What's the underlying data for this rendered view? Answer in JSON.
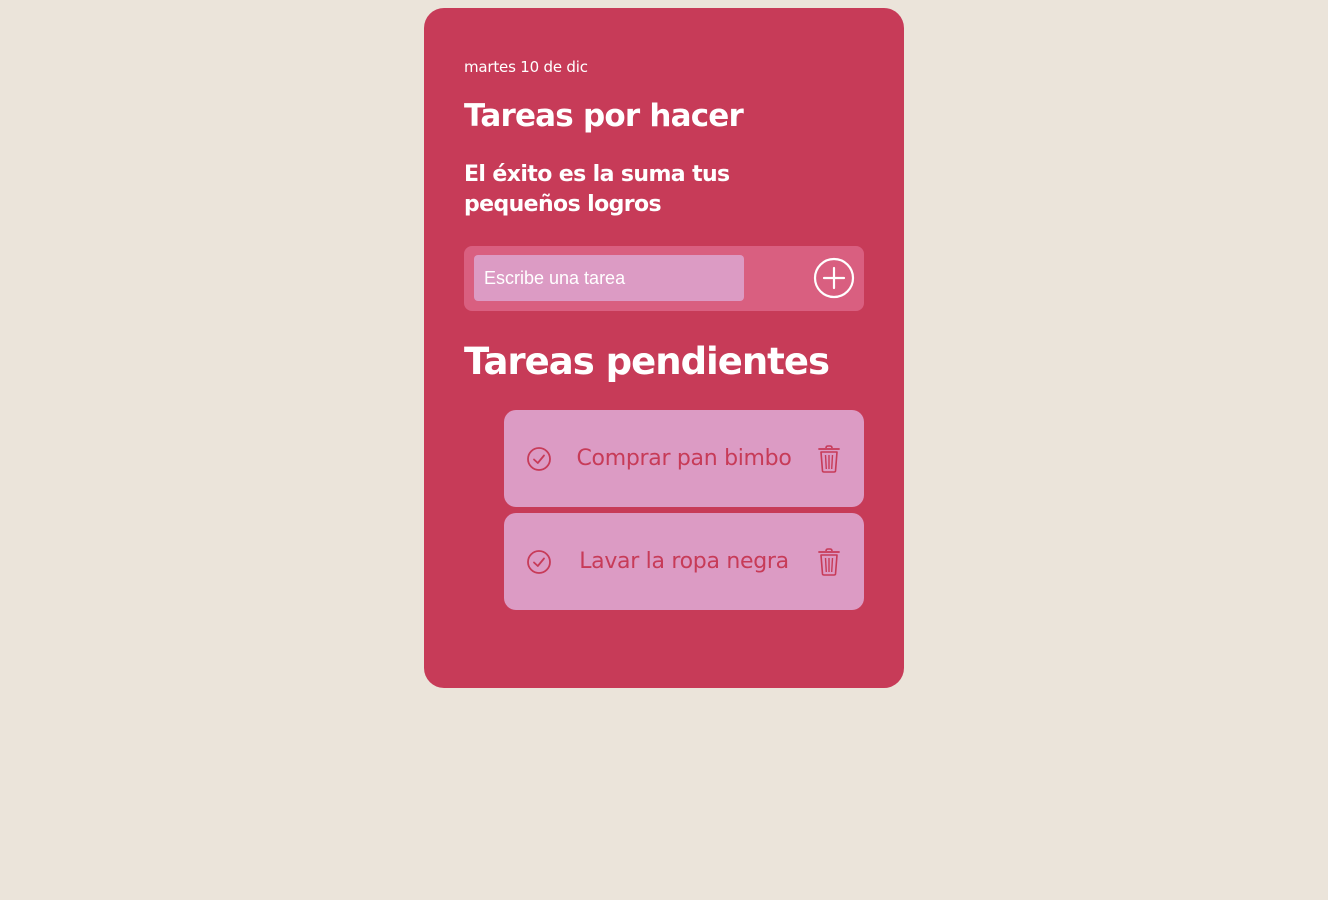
{
  "header": {
    "date": "martes 10 de dic",
    "title": "Tareas por hacer",
    "subtitle": "El éxito es la suma tus pequeños logros"
  },
  "input": {
    "placeholder": "Escribe una tarea",
    "value": "",
    "add_icon": "plus-circle-icon"
  },
  "pending": {
    "title": "Tareas pendientes",
    "tasks": [
      {
        "text": "Comprar pan bimbo",
        "check_icon": "check-circle-icon",
        "delete_icon": "trash-icon"
      },
      {
        "text": "Lavar la ropa negra",
        "check_icon": "check-circle-icon",
        "delete_icon": "trash-icon"
      }
    ]
  },
  "colors": {
    "background": "#ebe4da",
    "card": "#c73b58",
    "input_row": "#d95f80",
    "task_item": "#dc9bc4",
    "text_light": "#ffffff"
  }
}
